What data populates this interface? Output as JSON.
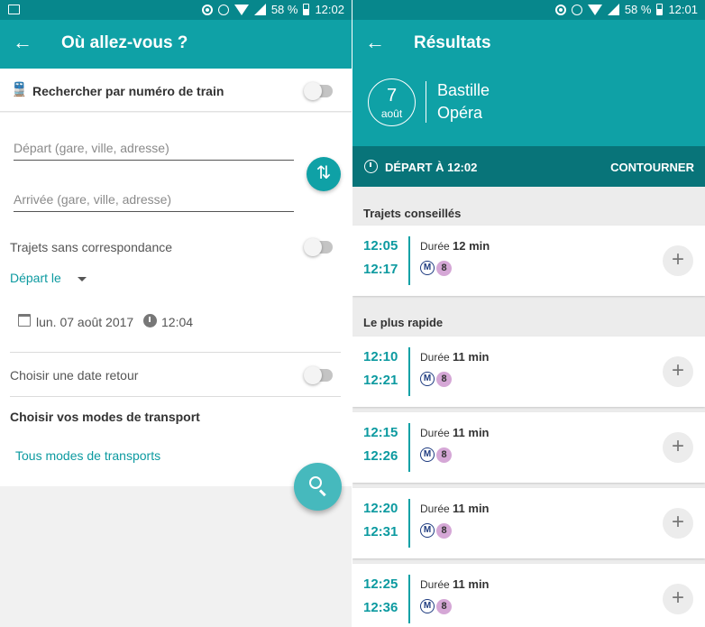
{
  "left": {
    "status": {
      "battery": "58 %",
      "time": "12:02"
    },
    "appbar": {
      "back_icon": "arrow-left-icon",
      "title": "Où allez-vous ?"
    },
    "train_search": {
      "label": "Rechercher par numéro de train",
      "enabled": false
    },
    "depart_field": {
      "placeholder": "Départ (gare, ville, adresse)",
      "value": ""
    },
    "arrivee_field": {
      "placeholder": "Arrivée (gare, ville, adresse)",
      "value": ""
    },
    "swap_icon": "swap-vertical-icon",
    "sans_correspondance": {
      "label": "Trajets sans correspondance",
      "enabled": false
    },
    "depart_mode": "Départ le",
    "date": "lun. 07 août 2017",
    "time": "12:04",
    "date_retour": {
      "label": "Choisir une date retour",
      "enabled": false
    },
    "modes": {
      "title": "Choisir vos modes de transport",
      "link": "Tous modes de transports"
    },
    "fab_icon": "search-icon"
  },
  "right": {
    "status": {
      "battery": "58 %",
      "time": "12:01"
    },
    "appbar": {
      "back_icon": "arrow-left-icon",
      "title": "Résultats"
    },
    "date": {
      "day": "7",
      "month": "août"
    },
    "route": {
      "from": "Bastille",
      "to": "Opéra"
    },
    "depart_bar": {
      "label": "DÉPART À 12:02",
      "action": "CONTOURNER"
    },
    "sections": {
      "conseilles": "Trajets conseillés",
      "rapide": "Le plus rapide"
    },
    "duree_label": "Durée",
    "metro_label": "M",
    "line_label": "8",
    "line_color": "#d5a7d6",
    "trips": [
      {
        "dep": "12:05",
        "arr": "12:17",
        "duration": "12 min"
      },
      {
        "dep": "12:10",
        "arr": "12:21",
        "duration": "11 min"
      },
      {
        "dep": "12:15",
        "arr": "12:26",
        "duration": "11 min"
      },
      {
        "dep": "12:20",
        "arr": "12:31",
        "duration": "11 min"
      },
      {
        "dep": "12:25",
        "arr": "12:36",
        "duration": "11 min"
      }
    ]
  },
  "colors": {
    "primary": "#0fa1a6",
    "primary_dark": "#087479",
    "status_bar": "#07878c"
  }
}
